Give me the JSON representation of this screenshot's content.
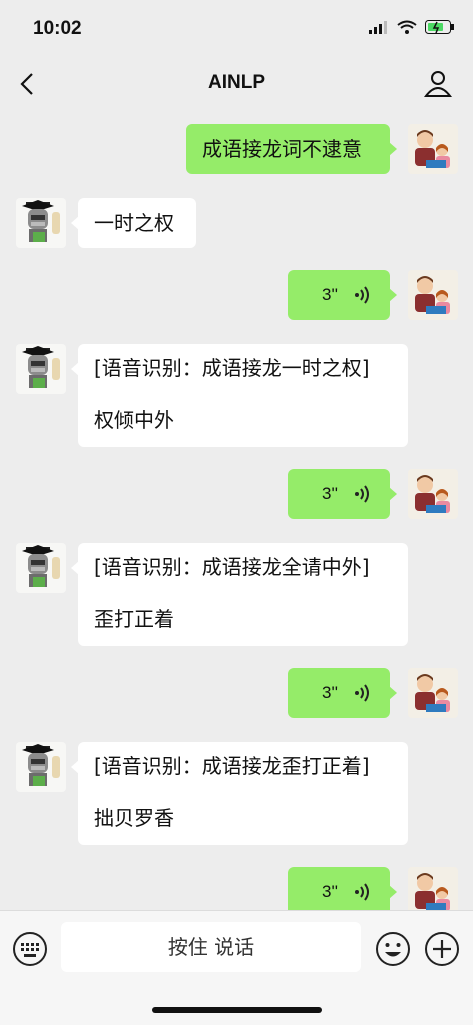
{
  "status": {
    "time": "10:02"
  },
  "nav": {
    "title": "AINLP"
  },
  "messages": [
    {
      "side": "right",
      "text": "成语接龙词不逮意"
    },
    {
      "side": "left",
      "text": "一时之权"
    },
    {
      "side": "right",
      "voice_duration": "3''"
    },
    {
      "side": "left",
      "line1": "[语音识别：成语接龙一时之权]",
      "line2": "权倾中外"
    },
    {
      "side": "right",
      "voice_duration": "3''"
    },
    {
      "side": "left",
      "line1": "[语音识别：成语接龙全请中外]",
      "line2": "歪打正着"
    },
    {
      "side": "right",
      "voice_duration": "3''"
    },
    {
      "side": "left",
      "line1": "[语音识别：成语接龙歪打正着]",
      "line2": "拙贝罗香"
    },
    {
      "side": "right",
      "voice_duration": "3''"
    }
  ],
  "input": {
    "hold_to_talk": "按住 说话"
  },
  "icons": {
    "back": "chevron-left-icon",
    "profile": "person-icon",
    "keyboard": "keyboard-icon",
    "emoji": "emoji-icon",
    "plus": "plus-icon",
    "voice": "voice-wave-icon"
  },
  "colors": {
    "sent_bubble": "#95ec69",
    "received_bubble": "#ffffff",
    "background": "#ededed"
  }
}
